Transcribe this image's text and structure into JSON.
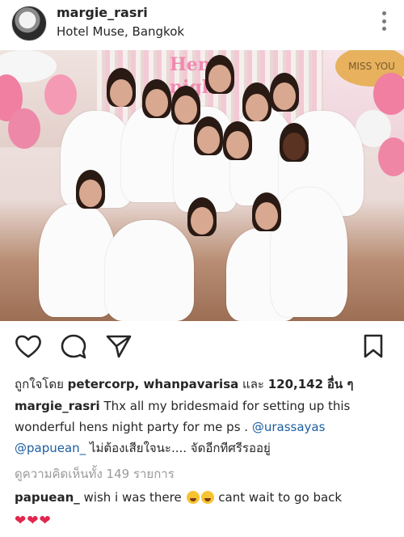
{
  "post": {
    "username": "margie_rasri",
    "location": "Hotel Muse, Bangkok"
  },
  "photo": {
    "banner_text": "Hens night",
    "balloon_text": "MISS YOU"
  },
  "likes": {
    "prefix": "ถูกใจโดย",
    "users": "petercorp, whanpavarisa",
    "joiner": "และ",
    "count": "120,142",
    "suffix": "อื่น ๆ"
  },
  "caption": {
    "username": "margie_rasri",
    "text": "Thx all my bridesmaid for setting up this wonderful hens night party for me ps .",
    "mention1": "@urassayas",
    "mention2": "@papuean_",
    "thai_text": "ไม่ต้องเสียใจนะ.... จัดอีกทีศรีรออยู่"
  },
  "view_comments": "ดูความคิดเห็นทั้ง 149 รายการ",
  "comment": {
    "username": "papuean_",
    "text_before": "wish i was there",
    "text_after": "cant wait to go back",
    "hearts": "❤❤❤"
  },
  "colors": {
    "mention": "#1c5fa0",
    "heart": "#e2264d",
    "muted": "#9a9a9a"
  },
  "icons": [
    "more-options-icon",
    "heart-icon",
    "comment-icon",
    "share-icon",
    "bookmark-icon"
  ]
}
